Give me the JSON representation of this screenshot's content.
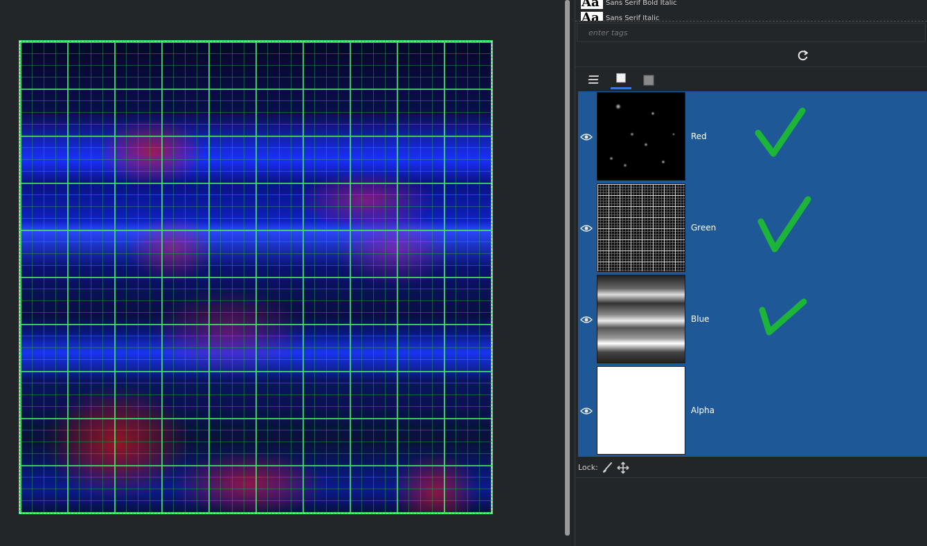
{
  "fonts": {
    "items": [
      {
        "sample": "Aa",
        "name": "Sans Serif Bold Italic"
      },
      {
        "sample": "Aa",
        "name": "Sans Serif Italic"
      }
    ]
  },
  "tags": {
    "placeholder": "enter tags",
    "value": ""
  },
  "panel_tabs": [
    {
      "icon": "layers-icon"
    },
    {
      "icon": "channels-icon",
      "active": true
    },
    {
      "icon": "paths-icon"
    }
  ],
  "channels": [
    {
      "name": "Red",
      "visible": true,
      "checked": true
    },
    {
      "name": "Green",
      "visible": true,
      "checked": true
    },
    {
      "name": "Blue",
      "visible": true,
      "checked": true
    },
    {
      "name": "Alpha",
      "visible": true,
      "checked": false
    }
  ],
  "lock": {
    "label": "Lock:"
  },
  "colors": {
    "selection": "#1f5896",
    "panel_bg": "#232629",
    "check_mark": "#1cb53a",
    "active_tab": "#3a7bd5"
  }
}
